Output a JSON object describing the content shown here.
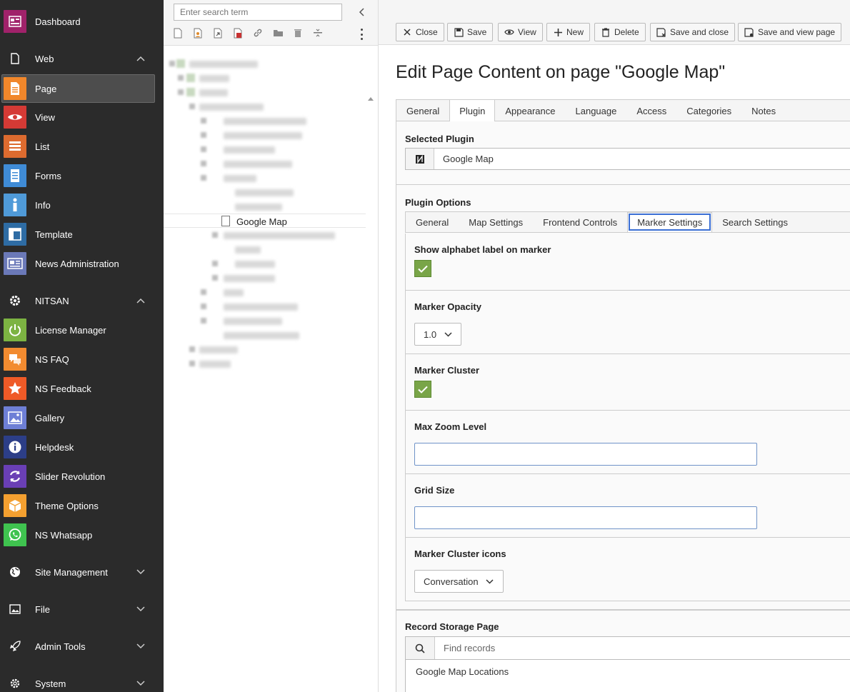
{
  "sidebar": {
    "groups": [
      {
        "label": "Web",
        "icon": "file-icon",
        "expanded": true
      },
      {
        "label": "NITSAN",
        "icon": "gear-icon",
        "expanded": true
      },
      {
        "label": "Site Management",
        "icon": "globe-icon",
        "expanded": false
      },
      {
        "label": "File",
        "icon": "image-icon",
        "expanded": false
      },
      {
        "label": "Admin Tools",
        "icon": "rocket-icon",
        "expanded": false
      },
      {
        "label": "System",
        "icon": "cog-icon",
        "expanded": false
      }
    ],
    "modules": [
      {
        "label": "Dashboard",
        "color": "#a0226a"
      },
      {
        "label": "Page",
        "color": "#f1872b"
      },
      {
        "label": "View",
        "color": "#d53a35"
      },
      {
        "label": "List",
        "color": "#dd6b2f"
      },
      {
        "label": "Forms",
        "color": "#3f8bd6"
      },
      {
        "label": "Info",
        "color": "#4f9ad8"
      },
      {
        "label": "Template",
        "color": "#2e6ca4"
      },
      {
        "label": "News Administration",
        "color": "#6b79b8"
      },
      {
        "label": "License Manager",
        "color": "#7cb342"
      },
      {
        "label": "NS FAQ",
        "color": "#f28b30"
      },
      {
        "label": "NS Feedback",
        "color": "#ef5a27"
      },
      {
        "label": "Gallery",
        "color": "#6e7fd6"
      },
      {
        "label": "Helpdesk",
        "color": "#2c3e87"
      },
      {
        "label": "Slider Revolution",
        "color": "#6a3fb5"
      },
      {
        "label": "Theme Options",
        "color": "#f4a030"
      },
      {
        "label": "NS Whatsapp",
        "color": "#3fc34f"
      }
    ]
  },
  "tree": {
    "search_placeholder": "Enter search term",
    "selected_page": "Google Map"
  },
  "toolbar": {
    "close": "Close",
    "save": "Save",
    "view": "View",
    "new": "New",
    "delete": "Delete",
    "save_close": "Save and close",
    "save_view": "Save and view page"
  },
  "title": "Edit Page Content on page \"Google Map\"",
  "main_tabs": [
    "General",
    "Plugin",
    "Appearance",
    "Language",
    "Access",
    "Categories",
    "Notes"
  ],
  "main_tab_active": "Plugin",
  "selected_plugin": {
    "label": "Selected Plugin",
    "value": "Google Map"
  },
  "plugin_options": {
    "label": "Plugin Options",
    "tabs": [
      "General",
      "Map Settings",
      "Frontend Controls",
      "Marker Settings",
      "Search Settings"
    ],
    "active_tab": "Marker Settings",
    "fields": {
      "alphabet_label": {
        "label": "Show alphabet label on marker",
        "checked": true
      },
      "opacity": {
        "label": "Marker Opacity",
        "value": "1.0"
      },
      "cluster": {
        "label": "Marker Cluster",
        "checked": true
      },
      "max_zoom": {
        "label": "Max Zoom Level",
        "value": ""
      },
      "grid_size": {
        "label": "Grid Size",
        "value": ""
      },
      "cluster_icons": {
        "label": "Marker Cluster icons",
        "value": "Conversation"
      }
    }
  },
  "record_storage": {
    "label": "Record Storage Page",
    "placeholder": "Find records",
    "items": [
      "Google Map Locations"
    ]
  },
  "colors": {
    "sidebar_bg": "#2b2b2b",
    "checkbox_green": "#79a548",
    "focus_blue": "#3b6fd4"
  }
}
